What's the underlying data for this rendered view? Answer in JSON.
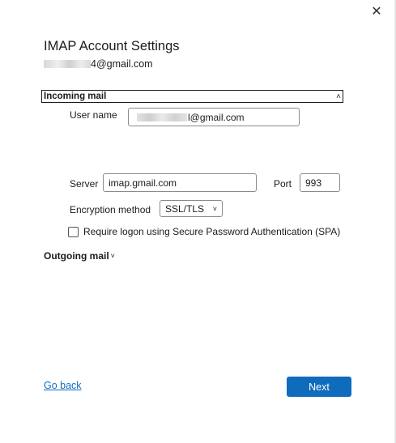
{
  "window": {
    "close_glyph": "✕",
    "close_icon": "close-icon"
  },
  "header": {
    "title": "IMAP Account Settings",
    "email_suffix": "4@gmail.com"
  },
  "incoming": {
    "section_label": "Incoming mail",
    "chevron_icon": "chevron-up-icon",
    "chevron_glyph": "˄",
    "username_label": "User name",
    "username_suffix": "l@gmail.com",
    "server_label": "Server",
    "server_value": "imap.gmail.com",
    "port_label": "Port",
    "port_value": "993",
    "encryption_label": "Encryption method",
    "encryption_value": "SSL/TLS",
    "encryption_chevron": "˅",
    "spa_label": "Require logon using Secure Password Authentication (SPA)",
    "spa_checked": false
  },
  "outgoing": {
    "section_label": "Outgoing mail",
    "chevron_glyph": "˅",
    "chevron_icon": "chevron-down-icon"
  },
  "footer": {
    "back_label": "Go back",
    "next_label": "Next"
  },
  "colors": {
    "accent": "#0f6cbd",
    "text": "#1b1b1b",
    "border": "#8a8a8a"
  }
}
